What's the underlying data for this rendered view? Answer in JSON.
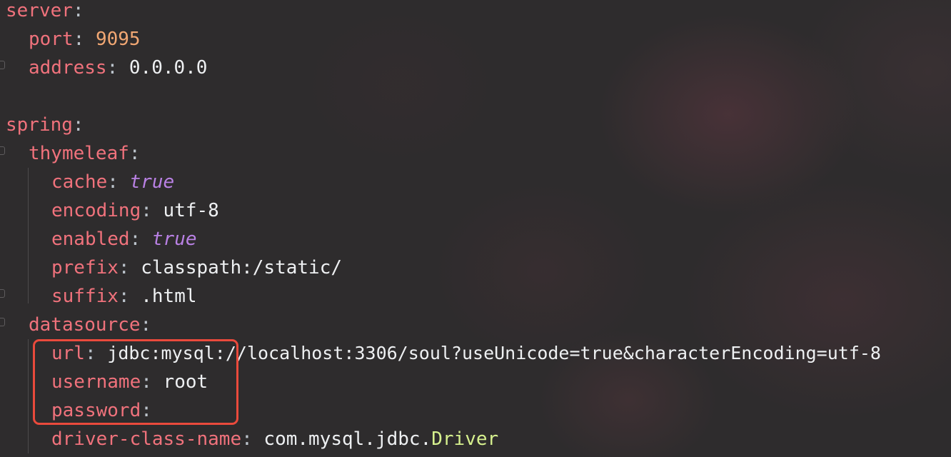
{
  "lines": [
    {
      "key": "server"
    },
    {
      "key": "port",
      "value": "9095"
    },
    {
      "key": "address",
      "value": "0.0.0.0"
    },
    {
      "key": "spring"
    },
    {
      "key": "thymeleaf"
    },
    {
      "key": "cache",
      "value": "true"
    },
    {
      "key": "encoding",
      "value": "utf-8"
    },
    {
      "key": "enabled",
      "value": "true"
    },
    {
      "key": "prefix",
      "value": "classpath:/static/"
    },
    {
      "key": "suffix",
      "value": ".html"
    },
    {
      "key": "datasource"
    },
    {
      "key": "url",
      "value": "jdbc:mysql://localhost:3306/soul?useUnicode=true&characterEncoding=utf-8"
    },
    {
      "key": "username",
      "value": "root"
    },
    {
      "key": "password"
    },
    {
      "key": "driver-class-name",
      "value_pkg": "com.mysql.jdbc.",
      "value_cls": "Driver"
    }
  ],
  "colon": ":",
  "colors": {
    "key": "#f0727c",
    "number": "#f1a773",
    "string": "#eef0f2",
    "boolean": "#b981e4",
    "class": "#d6f08e",
    "highlight_box": "#ea4a3c"
  }
}
